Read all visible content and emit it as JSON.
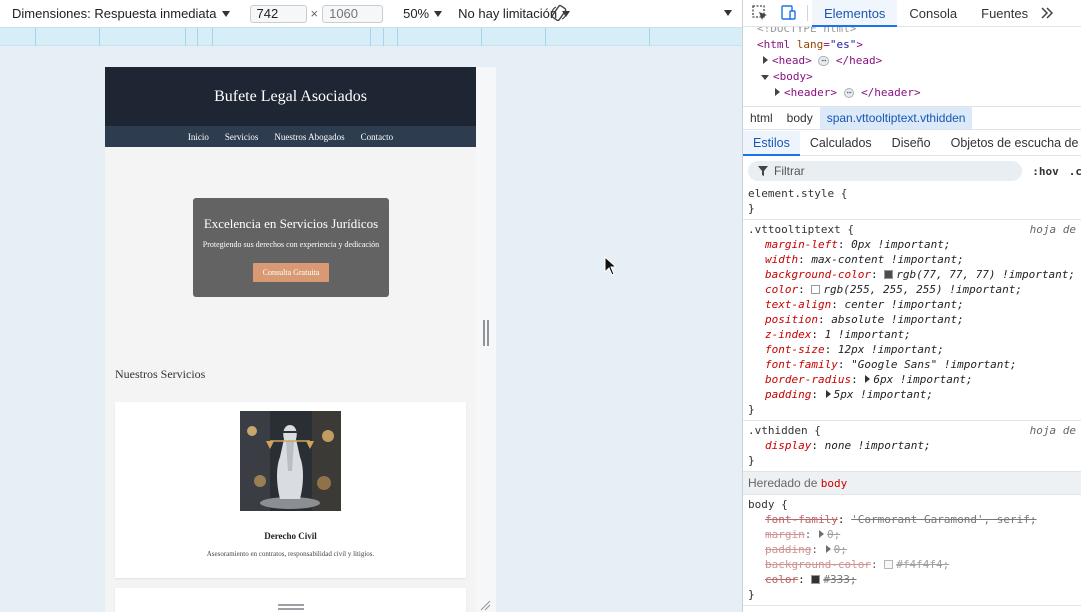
{
  "device_toolbar": {
    "dimensions_label": "Dimensiones: Respuesta inmediata",
    "width_value": "742",
    "height_placeholder": "1060",
    "times": "×",
    "zoom": "50%",
    "throttle": "No hay limitación"
  },
  "site": {
    "brand": "Bufete Legal Asociados",
    "nav": [
      "Inicio",
      "Servicios",
      "Nuestros Abogados",
      "Contacto"
    ],
    "hero": {
      "title": "Excelencia en Servicios Jurídicos",
      "subtitle": "Protegiendo sus derechos con experiencia y dedicación",
      "cta": "Consulta Gratuita"
    },
    "services_title": "Nuestros Servicios",
    "service": {
      "name": "Derecho Civil",
      "description": "Asesoramiento en contratos, responsabilidad civil y litigios."
    }
  },
  "devtools": {
    "tabs": [
      "Elementos",
      "Consola",
      "Fuentes"
    ],
    "active_tab": "Elementos",
    "dom": {
      "doctype": "<!DOCTYPE html>",
      "html_open": "<html",
      "html_attr": "lang",
      "html_attr_val": "\"es\"",
      "head_open": "<head>",
      "head_close": "</head>",
      "body_open": "<body>",
      "header_open": "<header>",
      "header_close": "</header>",
      "ellipsis": "⋯"
    },
    "breadcrumbs": [
      "html",
      "body",
      "span.vttooltiptext.vthidden"
    ],
    "sub_tabs": [
      "Estilos",
      "Calculados",
      "Diseño",
      "Objetos de escucha de eve"
    ],
    "filter_placeholder": "Filtrar",
    "hov": ":hov",
    "cls": ".c",
    "rules": {
      "element_style": "element.style {",
      "close": "}",
      "vttooltip_selector": ".vttooltiptext {",
      "source": "hoja de",
      "vttooltip_props": [
        {
          "name": "margin-left",
          "value": "0px !important;"
        },
        {
          "name": "width",
          "value": "max-content !important;"
        },
        {
          "name": "background-color",
          "value": "rgb(77, 77, 77) !important;",
          "swatch": "#4d4d4d"
        },
        {
          "name": "color",
          "value": "rgb(255, 255, 255) !important;",
          "swatch": "#ffffff"
        },
        {
          "name": "text-align",
          "value": "center !important;"
        },
        {
          "name": "position",
          "value": "absolute !important;"
        },
        {
          "name": "z-index",
          "value": "1 !important;"
        },
        {
          "name": "font-size",
          "value": "12px !important;"
        },
        {
          "name": "font-family",
          "value": "\"Google Sans\" !important;"
        },
        {
          "name": "border-radius",
          "value": "6px !important;",
          "expandable": true
        },
        {
          "name": "padding",
          "value": "5px !important;",
          "expandable": true
        }
      ],
      "vthidden_selector": ".vthidden {",
      "vthidden_props": [
        {
          "name": "display",
          "value": "none !important;"
        }
      ],
      "inherited_label": "Heredado de",
      "inherited_from": "body",
      "body_selector": "body {",
      "body_props": [
        {
          "name": "font-family",
          "value": "'Cormorant Garamond', serif;"
        },
        {
          "name": "margin",
          "value": "0;",
          "expandable": true
        },
        {
          "name": "padding",
          "value": "0;",
          "expandable": true
        },
        {
          "name": "background-color",
          "value": "#f4f4f4;",
          "swatch": "#f4f4f4"
        },
        {
          "name": "color",
          "value": "#333;",
          "swatch": "#333333"
        }
      ]
    }
  },
  "colors": {
    "header_bg": "#1e2533",
    "nav_bg": "#2d3c4e",
    "hero_card": "#636363",
    "cta": "#d99a73",
    "devtools_accent": "#1a73e8"
  }
}
